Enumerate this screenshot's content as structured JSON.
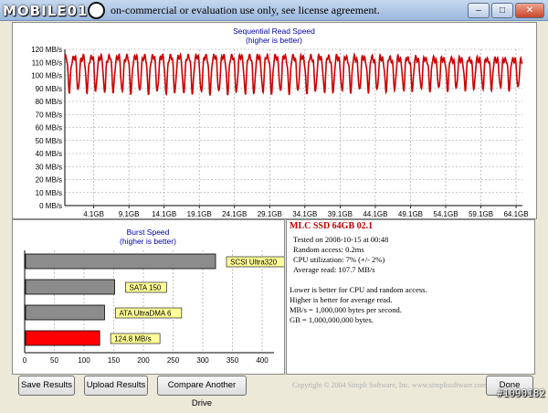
{
  "window": {
    "title": "on-commercial or evaluation use only, see license agreement.",
    "watermark": "MOBILE01",
    "watermark_tag": "#1090182",
    "controls": [
      "–",
      "□",
      "✕"
    ]
  },
  "chart_data": [
    {
      "type": "line",
      "title": "Sequential Read Speed",
      "subtitle": "(higher is better)",
      "ylabel": "MB/s",
      "ylim": [
        0,
        120
      ],
      "yticks": [
        "0 MB/s",
        "10 MB/s",
        "20 MB/s",
        "30 MB/s",
        "40 MB/s",
        "50 MB/s",
        "60 MB/s",
        "70 MB/s",
        "80 MB/s",
        "90 MB/s",
        "100 MB/s",
        "110 MB/s",
        "120 MB/s"
      ],
      "xticks": [
        "4.1GB",
        "9.1GB",
        "14.1GB",
        "19.1GB",
        "24.1GB",
        "29.1GB",
        "34.1GB",
        "39.1GB",
        "44.1GB",
        "49.1GB",
        "54.1GB",
        "59.1GB",
        "64.1GB"
      ],
      "xlim_gb": [
        0,
        65
      ],
      "series": [
        {
          "color": "#cc0000",
          "period_gb": 1.25,
          "high": 113,
          "low": 88
        }
      ],
      "grid": true
    },
    {
      "type": "bar",
      "orientation": "horizontal",
      "title": "Burst Speed",
      "subtitle": "(higher is better)",
      "xlim": [
        0,
        420
      ],
      "xticks": [
        0,
        50,
        100,
        150,
        200,
        250,
        300,
        350,
        400
      ],
      "bars": [
        {
          "label": "SCSI Ultra320",
          "value": 320,
          "color": "#8c8c8c"
        },
        {
          "label": "SATA 150",
          "value": 150,
          "color": "#8c8c8c"
        },
        {
          "label": "ATA UltraDMA 6",
          "value": 133,
          "color": "#8c8c8c"
        },
        {
          "label": "124.8 MB/s",
          "value": 124.8,
          "color": "#ff0000"
        }
      ],
      "grid": true
    }
  ],
  "info": {
    "drive_title": "MLC SSD 64GB 02.1",
    "tested": "Tested on 2008-10-15 at 00:48",
    "random_access": "Random access: 0.2ms",
    "cpu": "CPU utilization: 7% (+/- 2%)",
    "average": "Average read: 107.7 MB/s",
    "notes": [
      "Lower is better for CPU and random access.",
      "Higher is better for average read.",
      "MB/s = 1,000,000 bytes per second.",
      "GB = 1,000,000,000 bytes."
    ]
  },
  "buttons": {
    "save": "Save Results",
    "upload": "Upload Results",
    "compare": "Compare Another Drive",
    "done": "Done"
  },
  "footer": {
    "copyright": "Copyright © 2004 Simpli Software, Inc. www.simplisoftware.com"
  },
  "colors": {
    "accent": "#cc0000",
    "label_bg": "#ffff99"
  }
}
